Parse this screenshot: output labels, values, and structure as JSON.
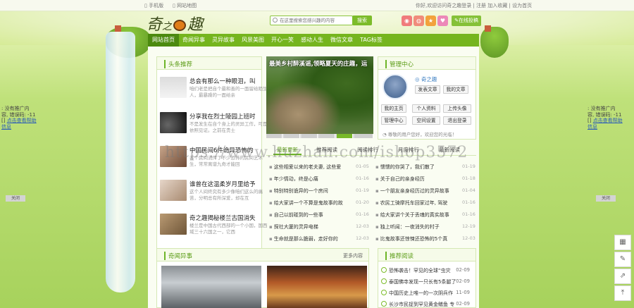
{
  "topbar": {
    "mobile_label": "手机版",
    "sitemap_label": "网站地图",
    "greeting": "你好,欢迎访问奇之趣",
    "login_label": "登录",
    "signup_label": "注册",
    "favorite_label": "加入收藏",
    "homepage_label": "设为首页"
  },
  "header": {
    "logo_text_left": "奇",
    "logo_text_mid": "之",
    "logo_text_right": "趣",
    "search_placeholder": "在这里搜索您感兴趣的内容",
    "search_button": "搜索",
    "post_button": "在线投稿"
  },
  "nav": {
    "items": [
      "网站首页",
      "奇闻异事",
      "灵异故事",
      "风景美图",
      "开心一笑",
      "感动人生",
      "微信文章",
      "TAG标签"
    ]
  },
  "headlines": {
    "title": "头条推荐",
    "items": [
      {
        "title": "总会有那么一种眼泪，叫",
        "desc": "咱们老是把自个最和善的一面留给陌生人，最暴躁的一面给亲"
      },
      {
        "title": "分享我在烈士陵园上班时",
        "desc": "不是发生在自个身上的灵异工作，可是依照见证。之前在贵士"
      },
      {
        "title": "中国民间6件诡异恐怖的",
        "desc": "各个民间流传了不少恐怖的民间艺术生，常常离谱九奇才能回"
      },
      {
        "title": "谁曾在这温柔岁月里给予",
        "desc": "这个人间终究有多少像咱们这么的痛苦，分明总有所深爱，却在互"
      },
      {
        "title": "奇之趣揭秘楼兰古国消失",
        "desc": "楼兰是中国古代西部的一个小国，国西域三十六国之一，它西"
      }
    ]
  },
  "slider": {
    "caption": "最美乡村醉溪谣,领略夏天的庄趣，运",
    "active_dot": 5,
    "dot_count": 6
  },
  "tabs": {
    "items": [
      "最新更新",
      "推荐阅读",
      "阅读排行",
      "月度排行",
      "最新阅读"
    ],
    "active": 0
  },
  "updates": {
    "left": [
      {
        "text": "这些相爱以来的老夫妻, 这些爱",
        "date": "01-05"
      },
      {
        "text": "年少情动，终是心痛",
        "date": "01-16"
      },
      {
        "text": "特别特别诡异的一个房间",
        "date": "01-19"
      },
      {
        "text": "给大家讲一个不算是鬼故事的故",
        "date": "01-20"
      },
      {
        "text": "自己以前碰到的一些事",
        "date": "01-16"
      },
      {
        "text": "探社大厦的灵异电梯",
        "date": "12-03"
      },
      {
        "text": "生命就是那么脆弱，走好你的",
        "date": "12-03"
      }
    ],
    "right": [
      {
        "text": "懦懦的你哭了，我们散了",
        "date": "01-19"
      },
      {
        "text": "关于自己的亲身经历",
        "date": "01-18"
      },
      {
        "text": "一个朋友亲身经历过的灵异故事",
        "date": "01-04"
      },
      {
        "text": "农民工骑摩托车回家过年, 驾驶",
        "date": "01-16"
      },
      {
        "text": "给大家讲个关于丢魂的真实故事",
        "date": "01-16"
      },
      {
        "text": "独上听闻：一夜消失的村子",
        "date": "12-19"
      },
      {
        "text": "比鬼故事还惊悚还恐怖的5个真",
        "date": "12-03"
      }
    ]
  },
  "member": {
    "title": "管理中心",
    "name": "奇之趣",
    "buttons_top": [
      "发表文章",
      "我的文章"
    ],
    "buttons_grid": [
      "我的主页",
      "个人资料",
      "上传头像",
      "管理中心",
      "空间设置",
      "退出登录"
    ],
    "tip": "尊敬的用户您好，欢迎您的光临！"
  },
  "side_ads": {
    "line1": "没有推广内",
    "line2": "容, 错误码: -11",
    "link1": "点击查看帮助",
    "link2": "信息",
    "close": "关闭"
  },
  "weird_section": {
    "title": "奇闻异事",
    "more": "更多内容"
  },
  "recommend": {
    "title": "推荐阅读",
    "items": [
      {
        "text": "恐怖袭击！罕见的全球“虫灾",
        "date": "02-09"
      },
      {
        "text": "泰国佛寺发现一只长有5条腿了",
        "date": "02-09"
      },
      {
        "text": "中国历史上唯一的一次阴兵作",
        "date": "11-09"
      },
      {
        "text": "长沙市民捉到罕见黄金鳝鱼 专",
        "date": "02-09"
      }
    ]
  },
  "watermark": "https://www.huzhan.com/ishop3572",
  "colors": {
    "nav_bg": "#75b51e",
    "nav_active": "#4c8a0f",
    "accent": "#6db528"
  }
}
